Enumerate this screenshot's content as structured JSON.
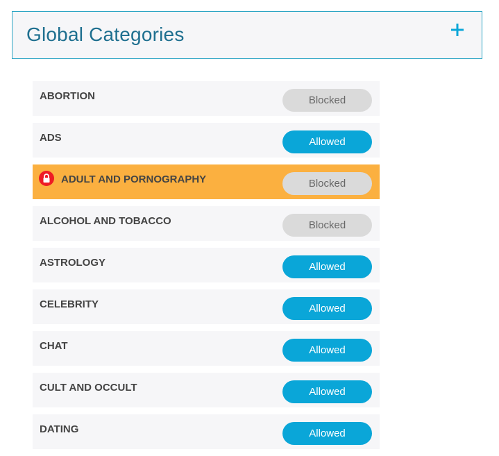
{
  "header": {
    "title": "Global Categories",
    "add_icon": "plus-icon"
  },
  "colors": {
    "accent": "#0aa6d8",
    "locked_row": "#fbb040",
    "lock_badge": "#ee1c24",
    "blocked_pill": "#dadada"
  },
  "categories": [
    {
      "name": "ABORTION",
      "status": "Blocked",
      "locked": false
    },
    {
      "name": "ADS",
      "status": "Allowed",
      "locked": false
    },
    {
      "name": "ADULT AND PORNOGRAPHY",
      "status": "Blocked",
      "locked": true,
      "icon": "lock-icon"
    },
    {
      "name": "ALCOHOL AND TOBACCO",
      "status": "Blocked",
      "locked": false
    },
    {
      "name": "ASTROLOGY",
      "status": "Allowed",
      "locked": false
    },
    {
      "name": "CELEBRITY",
      "status": "Allowed",
      "locked": false
    },
    {
      "name": "CHAT",
      "status": "Allowed",
      "locked": false
    },
    {
      "name": "CULT AND OCCULT",
      "status": "Allowed",
      "locked": false
    },
    {
      "name": "DATING",
      "status": "Allowed",
      "locked": false
    }
  ]
}
